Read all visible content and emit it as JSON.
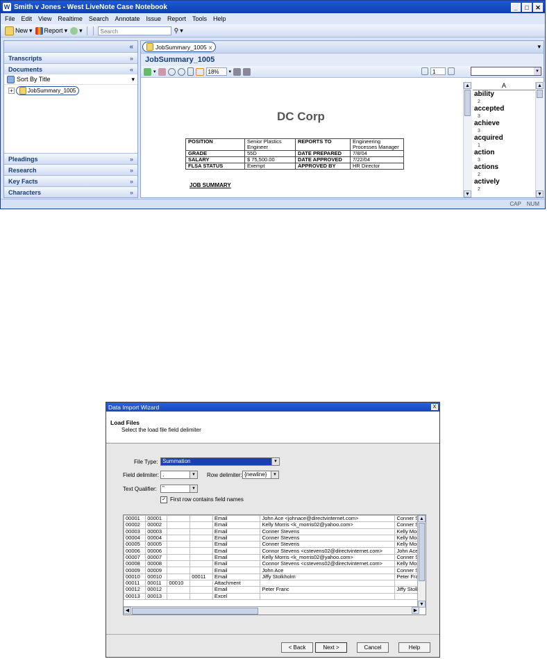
{
  "window": {
    "title": "Smith v Jones - West LiveNote Case Notebook",
    "menu": [
      "File",
      "Edit",
      "View",
      "Realtime",
      "Search",
      "Annotate",
      "Issue",
      "Report",
      "Tools",
      "Help"
    ],
    "toolbar": {
      "new_label": "New",
      "report_label": "Report",
      "search_placeholder": "Search"
    },
    "left_panel": {
      "collapse_glyph": "«",
      "transcripts": "Transcripts",
      "documents": "Documents",
      "sort_label": "Sort By Title",
      "tree_item": "JobSummary_1005",
      "pleadings": "Pleadings",
      "research": "Research",
      "key_facts": "Key Facts",
      "characters": "Characters"
    },
    "doc_tab": {
      "label": "JobSummary_1005",
      "close": "x"
    },
    "doc_title": "JobSummary_1005",
    "view_toolbar": {
      "zoom": "18%",
      "page": "1"
    },
    "document": {
      "company": "DC Corp",
      "rows": [
        [
          "POSITION",
          "Senior Plastics Engineer",
          "REPORTS TO",
          "Engineering Processes Manager"
        ],
        [
          "GRADE",
          "55D",
          "DATE PREPARED",
          "7/8/04"
        ],
        [
          "SALARY",
          "$ 75,500.00",
          "DATE APPROVED",
          "7/22/04"
        ],
        [
          "FLSA STATUS",
          "Exempt",
          "APPROVED BY",
          "HR Director"
        ]
      ],
      "section": "JOB SUMMARY"
    },
    "wordlist": {
      "header": "A",
      "words": [
        {
          "word": "ability",
          "count": "2"
        },
        {
          "word": "accepted",
          "count": "3"
        },
        {
          "word": "achieve",
          "count": "3"
        },
        {
          "word": "acquired",
          "count": "1"
        },
        {
          "word": "action",
          "count": "3"
        },
        {
          "word": "actions",
          "count": "2"
        },
        {
          "word": "actively",
          "count": "2"
        }
      ]
    },
    "status": {
      "cap": "CAP",
      "num": "NUM"
    }
  },
  "dialog": {
    "title": "Data Import Wizard",
    "close": "X",
    "heading": "Load Files",
    "subheading": "Select the load file field delimiter",
    "file_type_label": "File Type:",
    "file_type_value": "Summation",
    "field_delim_label": "Field delimiter:",
    "field_delim_value": ",",
    "row_delim_label": "Row delimiter:",
    "row_delim_value": "{newline}",
    "text_qual_label": "Text Qualifier:",
    "text_qual_value": "\"",
    "first_row_label": "First row contains field names",
    "rows": [
      [
        "00001",
        "00001",
        "",
        "",
        "Email",
        "John Ace <johnace@directvinternet.com>",
        "Conner St"
      ],
      [
        "00002",
        "00002",
        "",
        "",
        "Email",
        "Kelly Morris <k_morris02@yahoo.com>",
        "Conner St"
      ],
      [
        "00003",
        "00003",
        "",
        "",
        "Email",
        "Conner Stevens",
        "Kelly Morr"
      ],
      [
        "00004",
        "00004",
        "",
        "",
        "Email",
        "Conner Stevens",
        "Kelly Morr"
      ],
      [
        "00005",
        "00005",
        "",
        "",
        "Email",
        "Conner Stevens",
        "Kelly Morr"
      ],
      [
        "00006",
        "00006",
        "",
        "",
        "Email",
        "Connor Stevens <cstevens02@directvinternet.com>",
        "John Ace"
      ],
      [
        "00007",
        "00007",
        "",
        "",
        "Email",
        "Kelly Morris <k_morris02@yahoo.com>",
        "Conner St"
      ],
      [
        "00008",
        "00008",
        "",
        "",
        "Email",
        "Connor Stevens <cstevens02@directvinternet.com>",
        "Kelly Morr"
      ],
      [
        "00009",
        "00009",
        "",
        "",
        "Email",
        "John Ace",
        "Conner St"
      ],
      [
        "00010",
        "00010",
        "",
        "00011",
        "Email",
        "Jiffy Stolkholm",
        "Peter Fra"
      ],
      [
        "00011",
        "00011",
        "00010",
        "",
        "Attachment",
        "",
        ""
      ],
      [
        "00012",
        "00012",
        "",
        "",
        "Email",
        "Peter Franc",
        "Jiffy Stolk"
      ],
      [
        "00013",
        "00013",
        "",
        "",
        "Excel",
        "",
        ""
      ]
    ],
    "buttons": {
      "back": "< Back",
      "next": "Next >",
      "cancel": "Cancel",
      "help": "Help"
    }
  }
}
